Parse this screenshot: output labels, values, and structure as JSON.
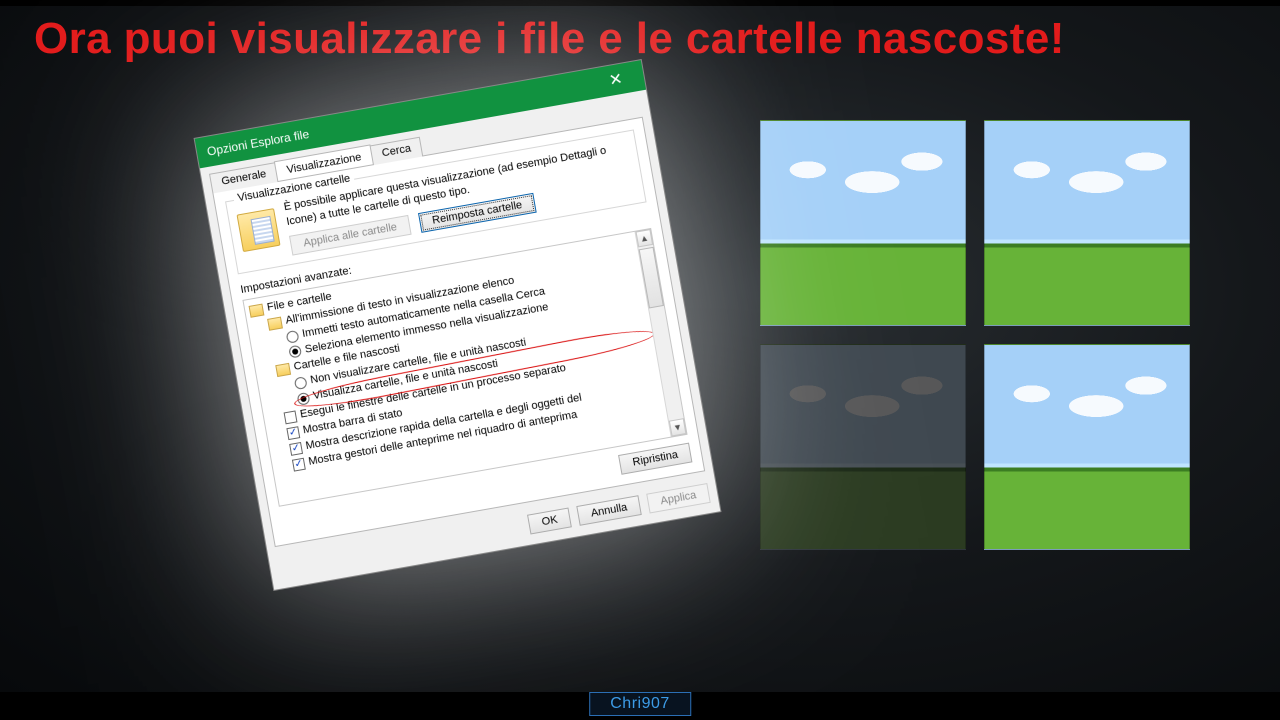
{
  "banner": "Ora puoi visualizzare i file e le cartelle nascoste!",
  "watermark": "Chri907",
  "dialog": {
    "title": "Opzioni Esplora file",
    "tabs": [
      "Generale",
      "Visualizzazione",
      "Cerca"
    ],
    "active_tab_index": 1,
    "folder_views": {
      "group_title": "Visualizzazione cartelle",
      "description": "È possibile applicare questa visualizzazione (ad esempio Dettagli o Icone) a tutte le cartelle di questo tipo.",
      "apply_btn": "Applica alle cartelle",
      "reset_btn": "Reimposta cartelle"
    },
    "advanced": {
      "label": "Impostazioni avanzate:",
      "root": "File e cartelle",
      "item_typeahead_group": "All'immissione di testo in visualizzazione elenco",
      "item_typeahead_opt1": "Immetti testo automaticamente nella casella Cerca",
      "item_typeahead_opt2": "Seleziona elemento immesso nella visualizzazione",
      "item_hidden_group": "Cartelle e file nascosti",
      "item_hidden_opt1": "Non visualizzare cartelle, file e unità nascosti",
      "item_hidden_opt2": "Visualizza cartelle, file e unità nascosti",
      "item_separate_process": "Esegui le finestre delle cartelle in un processo separato",
      "item_status_bar": "Mostra barra di stato",
      "item_tooltip": "Mostra descrizione rapida della cartella e degli oggetti del",
      "item_preview_handlers": "Mostra gestori delle anteprime nel riquadro di anteprima",
      "restore_btn": "Ripristina"
    },
    "footer": {
      "ok": "OK",
      "cancel": "Annulla",
      "apply": "Applica"
    }
  }
}
